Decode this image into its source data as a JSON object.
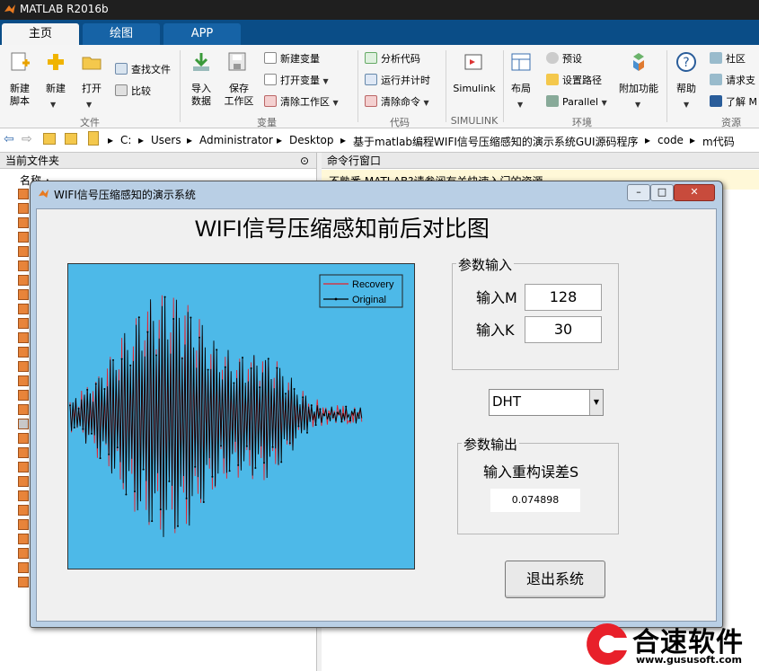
{
  "window": {
    "title": "MATLAB R2016b"
  },
  "tabs": [
    "主页",
    "绘图",
    "APP"
  ],
  "ribbon": {
    "file": {
      "new_script": "新建\n脚本",
      "new": "新建",
      "open": "打开",
      "find_files": "查找文件",
      "compare": "比较",
      "section": "文件"
    },
    "variable": {
      "import": "导入\n数据",
      "save": "保存\n工作区",
      "new_var": "新建变量",
      "open_var": "打开变量",
      "clear_ws": "清除工作区",
      "section": "变量"
    },
    "code": {
      "analyze": "分析代码",
      "run_time": "运行并计时",
      "clear_cmd": "清除命令",
      "section": "代码"
    },
    "simulink": {
      "label": "Simulink",
      "section": "SIMULINK"
    },
    "env": {
      "layout": "布局",
      "prefs": "预设",
      "set_path": "设置路径",
      "parallel": "Parallel",
      "addons": "附加功能",
      "section": "环境"
    },
    "resources": {
      "help": "帮助",
      "community": "社区",
      "support": "请求支",
      "learn": "了解 M",
      "section": "资源"
    }
  },
  "address": [
    "C:",
    "Users",
    "Administrator",
    "Desktop",
    "基于matlab编程WIFI信号压缩感知的演示系统GUI源码程序",
    "code",
    "m代码"
  ],
  "left_panel": {
    "title": "当前文件夹",
    "column": "名称"
  },
  "right_panel": {
    "title": "命令行窗口",
    "notice": "不熟悉 MATLAB?请参阅有关快速入门的资源。"
  },
  "figure": {
    "title": "WIFI信号压缩感知的演示系统",
    "main_title": "WIFI信号压缩感知前后对比图",
    "legend": [
      {
        "label": "Recovery",
        "color": "#e8202a"
      },
      {
        "label": "Original",
        "color": "#000000"
      }
    ],
    "params_in": {
      "title": "参数输入",
      "m_label": "输入M",
      "m_value": "128",
      "k_label": "输入K",
      "k_value": "30"
    },
    "method": {
      "selected": "DHT"
    },
    "params_out": {
      "title": "参数输出",
      "s_label": "输入重构误差S",
      "s_value": "0.074898"
    },
    "exit_button": "退出系统"
  },
  "watermark": {
    "name": "合速软件",
    "url": "www.gususoft.com"
  }
}
